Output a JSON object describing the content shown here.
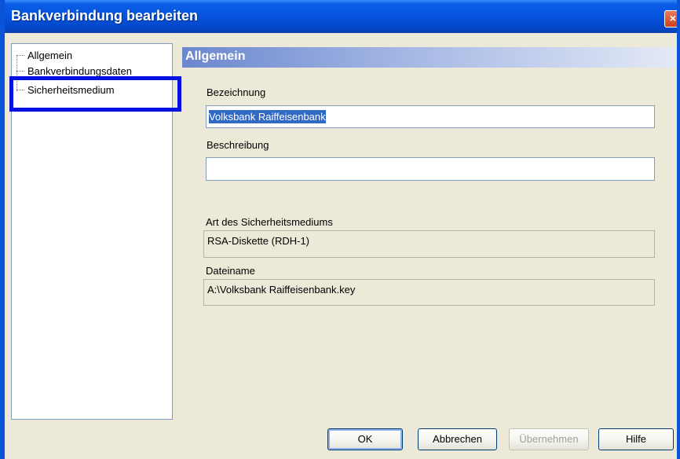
{
  "window": {
    "title": "Bankverbindung bearbeiten",
    "close_glyph": "×"
  },
  "tree": {
    "items": [
      {
        "label": "Allgemein"
      },
      {
        "label": "Bankverbindungsdaten"
      },
      {
        "label": "Sicherheitsmedium"
      }
    ]
  },
  "panel": {
    "header": "Allgemein",
    "bezeichnung_label": "Bezeichnung",
    "bezeichnung_value": "Volksbank Raiffeisenbank",
    "beschreibung_label": "Beschreibung",
    "beschreibung_value": "",
    "art_label": "Art des Sicherheitsmediums",
    "art_value": "RSA-Diskette (RDH-1)",
    "dateiname_label": "Dateiname",
    "dateiname_value": "A:\\Volksbank Raiffeisenbank.key"
  },
  "buttons": {
    "ok": "OK",
    "abbrechen": "Abbrechen",
    "uebernehmen": "Übernehmen",
    "hilfe": "Hilfe"
  },
  "colors": {
    "titlebar": "#0553de",
    "highlight": "#0010e0",
    "selection": "#316ac5"
  }
}
